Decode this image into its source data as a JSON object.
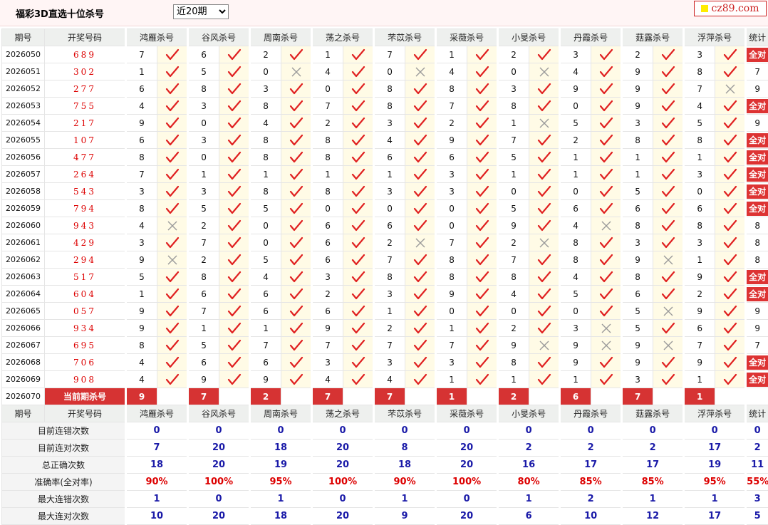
{
  "header": {
    "title": "福彩3D直选十位杀号",
    "period_select": "近20期",
    "logo": "cz89.com"
  },
  "columns": {
    "period": "期号",
    "draw": "开奖号码",
    "experts": [
      "鸿雁杀号",
      "谷风杀号",
      "周南杀号",
      "荡之杀号",
      "芣苡杀号",
      "采薇杀号",
      "小旻杀号",
      "丹霞杀号",
      "菇露杀号",
      "浮萍杀号"
    ],
    "stat": "统计"
  },
  "rows": [
    {
      "period": "2026050",
      "draw": "689",
      "kills": [
        7,
        6,
        2,
        1,
        7,
        1,
        2,
        3,
        2,
        3
      ],
      "hits": [
        1,
        1,
        1,
        1,
        1,
        1,
        1,
        1,
        1,
        1
      ],
      "stat": "全对"
    },
    {
      "period": "2026051",
      "draw": "302",
      "kills": [
        1,
        5,
        0,
        4,
        0,
        4,
        0,
        4,
        9,
        8
      ],
      "hits": [
        1,
        1,
        0,
        1,
        0,
        1,
        0,
        1,
        1,
        1
      ],
      "stat": "7"
    },
    {
      "period": "2026052",
      "draw": "277",
      "kills": [
        6,
        8,
        3,
        0,
        8,
        8,
        3,
        9,
        9,
        7
      ],
      "hits": [
        1,
        1,
        1,
        1,
        1,
        1,
        1,
        1,
        1,
        0
      ],
      "stat": "9"
    },
    {
      "period": "2026053",
      "draw": "755",
      "kills": [
        4,
        3,
        8,
        7,
        8,
        7,
        8,
        0,
        9,
        4
      ],
      "hits": [
        1,
        1,
        1,
        1,
        1,
        1,
        1,
        1,
        1,
        1
      ],
      "stat": "全对"
    },
    {
      "period": "2026054",
      "draw": "217",
      "kills": [
        9,
        0,
        4,
        2,
        3,
        2,
        1,
        5,
        3,
        5
      ],
      "hits": [
        1,
        1,
        1,
        1,
        1,
        1,
        0,
        1,
        1,
        1
      ],
      "stat": "9"
    },
    {
      "period": "2026055",
      "draw": "107",
      "kills": [
        6,
        3,
        8,
        8,
        4,
        9,
        7,
        2,
        8,
        8
      ],
      "hits": [
        1,
        1,
        1,
        1,
        1,
        1,
        1,
        1,
        1,
        1
      ],
      "stat": "全对"
    },
    {
      "period": "2026056",
      "draw": "477",
      "kills": [
        8,
        0,
        8,
        8,
        6,
        6,
        5,
        1,
        1,
        1
      ],
      "hits": [
        1,
        1,
        1,
        1,
        1,
        1,
        1,
        1,
        1,
        1
      ],
      "stat": "全对"
    },
    {
      "period": "2026057",
      "draw": "264",
      "kills": [
        7,
        1,
        1,
        1,
        1,
        3,
        1,
        1,
        1,
        3
      ],
      "hits": [
        1,
        1,
        1,
        1,
        1,
        1,
        1,
        1,
        1,
        1
      ],
      "stat": "全对"
    },
    {
      "period": "2026058",
      "draw": "543",
      "kills": [
        3,
        3,
        8,
        8,
        3,
        3,
        0,
        0,
        5,
        0
      ],
      "hits": [
        1,
        1,
        1,
        1,
        1,
        1,
        1,
        1,
        1,
        1
      ],
      "stat": "全对"
    },
    {
      "period": "2026059",
      "draw": "794",
      "kills": [
        8,
        5,
        5,
        0,
        0,
        0,
        5,
        6,
        6,
        6
      ],
      "hits": [
        1,
        1,
        1,
        1,
        1,
        1,
        1,
        1,
        1,
        1
      ],
      "stat": "全对"
    },
    {
      "period": "2026060",
      "draw": "943",
      "kills": [
        4,
        2,
        0,
        6,
        6,
        0,
        9,
        4,
        8,
        8
      ],
      "hits": [
        0,
        1,
        1,
        1,
        1,
        1,
        1,
        0,
        1,
        1
      ],
      "stat": "8"
    },
    {
      "period": "2026061",
      "draw": "429",
      "kills": [
        3,
        7,
        0,
        6,
        2,
        7,
        2,
        8,
        3,
        3
      ],
      "hits": [
        1,
        1,
        1,
        1,
        0,
        1,
        0,
        1,
        1,
        1
      ],
      "stat": "8"
    },
    {
      "period": "2026062",
      "draw": "294",
      "kills": [
        9,
        2,
        5,
        6,
        7,
        8,
        7,
        8,
        9,
        1
      ],
      "hits": [
        0,
        1,
        1,
        1,
        1,
        1,
        1,
        1,
        0,
        1
      ],
      "stat": "8"
    },
    {
      "period": "2026063",
      "draw": "517",
      "kills": [
        5,
        8,
        4,
        3,
        8,
        8,
        8,
        4,
        8,
        9
      ],
      "hits": [
        1,
        1,
        1,
        1,
        1,
        1,
        1,
        1,
        1,
        1
      ],
      "stat": "全对"
    },
    {
      "period": "2026064",
      "draw": "604",
      "kills": [
        1,
        6,
        6,
        2,
        3,
        9,
        4,
        5,
        6,
        2
      ],
      "hits": [
        1,
        1,
        1,
        1,
        1,
        1,
        1,
        1,
        1,
        1
      ],
      "stat": "全对"
    },
    {
      "period": "2026065",
      "draw": "057",
      "kills": [
        9,
        7,
        6,
        6,
        1,
        0,
        0,
        0,
        5,
        9
      ],
      "hits": [
        1,
        1,
        1,
        1,
        1,
        1,
        1,
        1,
        0,
        1
      ],
      "stat": "9"
    },
    {
      "period": "2026066",
      "draw": "934",
      "kills": [
        9,
        1,
        1,
        9,
        2,
        1,
        2,
        3,
        5,
        6
      ],
      "hits": [
        1,
        1,
        1,
        1,
        1,
        1,
        1,
        0,
        1,
        1
      ],
      "stat": "9"
    },
    {
      "period": "2026067",
      "draw": "695",
      "kills": [
        8,
        5,
        7,
        7,
        7,
        7,
        9,
        9,
        9,
        7
      ],
      "hits": [
        1,
        1,
        1,
        1,
        1,
        1,
        0,
        0,
        0,
        1
      ],
      "stat": "7"
    },
    {
      "period": "2026068",
      "draw": "706",
      "kills": [
        4,
        6,
        6,
        3,
        3,
        3,
        8,
        9,
        9,
        9
      ],
      "hits": [
        1,
        1,
        1,
        1,
        1,
        1,
        1,
        1,
        1,
        1
      ],
      "stat": "全对"
    },
    {
      "period": "2026069",
      "draw": "908",
      "kills": [
        4,
        9,
        9,
        4,
        4,
        1,
        1,
        1,
        3,
        1
      ],
      "hits": [
        1,
        1,
        1,
        1,
        1,
        1,
        1,
        1,
        1,
        1
      ],
      "stat": "全对"
    }
  ],
  "current": {
    "period": "2026070",
    "label": "当前期杀号",
    "kills": [
      9,
      7,
      2,
      7,
      7,
      1,
      2,
      6,
      7,
      1
    ]
  },
  "summary": [
    {
      "label": "目前连错次数",
      "values": [
        "0",
        "0",
        "0",
        "0",
        "0",
        "0",
        "0",
        "0",
        "0",
        "0"
      ],
      "stat": "0",
      "red": false
    },
    {
      "label": "目前连对次数",
      "values": [
        "7",
        "20",
        "18",
        "20",
        "8",
        "20",
        "2",
        "2",
        "2",
        "17"
      ],
      "stat": "2",
      "red": false
    },
    {
      "label": "总正确次数",
      "values": [
        "18",
        "20",
        "19",
        "20",
        "18",
        "20",
        "16",
        "17",
        "17",
        "19"
      ],
      "stat": "11",
      "red": false
    },
    {
      "label": "准确率(全对率)",
      "values": [
        "90%",
        "100%",
        "95%",
        "100%",
        "90%",
        "100%",
        "80%",
        "85%",
        "85%",
        "95%"
      ],
      "stat": "55%",
      "red": true
    },
    {
      "label": "最大连错次数",
      "values": [
        "1",
        "0",
        "1",
        "0",
        "1",
        "0",
        "1",
        "2",
        "1",
        "1"
      ],
      "stat": "3",
      "red": false
    },
    {
      "label": "最大连对次数",
      "values": [
        "10",
        "20",
        "18",
        "20",
        "9",
        "20",
        "6",
        "10",
        "12",
        "17"
      ],
      "stat": "5",
      "red": false
    }
  ],
  "colors": {
    "accent": "#d63333",
    "check": "#e02020",
    "cross": "#9a9a9a",
    "value_blue": "#1a1aa8"
  }
}
